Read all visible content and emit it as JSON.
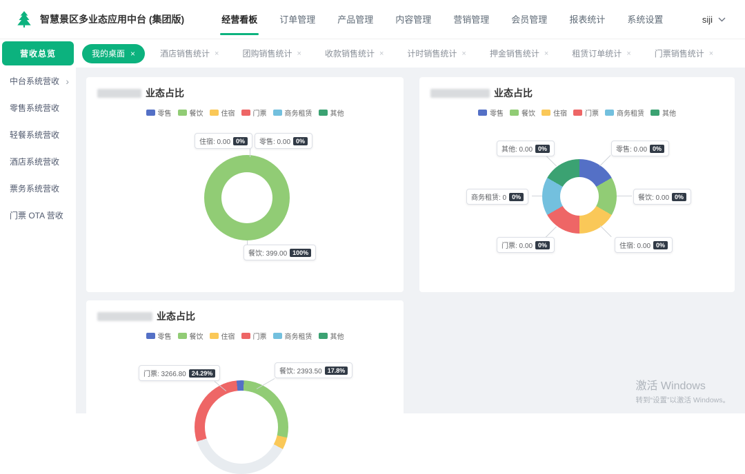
{
  "header": {
    "title": "智慧景区多业态应用中台 (集团版)",
    "nav_items": [
      {
        "label": "经营看板",
        "active": true
      },
      {
        "label": "订单管理"
      },
      {
        "label": "产品管理"
      },
      {
        "label": "内容管理"
      },
      {
        "label": "营销管理"
      },
      {
        "label": "会员管理"
      },
      {
        "label": "报表统计"
      },
      {
        "label": "系统设置"
      }
    ],
    "user_name": "siji"
  },
  "tabbar": {
    "overview_label": "营收总览",
    "active_tab_label": "我的桌面",
    "close_glyph": "×",
    "tabs": [
      "酒店销售统计",
      "团购销售统计",
      "收款销售统计",
      "计时销售统计",
      "押金销售统计",
      "租赁订单统计",
      "门票销售统计"
    ]
  },
  "sidebar": {
    "expand_glyph": "›",
    "items": [
      "中台系统营收",
      "零售系统营收",
      "轻餐系统营收",
      "酒店系统营收",
      "票务系统营收",
      "门票 OTA 营收"
    ]
  },
  "legend": [
    {
      "label": "零售",
      "color": "#5470c6"
    },
    {
      "label": "餐饮",
      "color": "#91cc75"
    },
    {
      "label": "住宿",
      "color": "#fac858"
    },
    {
      "label": "门票",
      "color": "#ee6666"
    },
    {
      "label": "商务租赁",
      "color": "#73c0de"
    },
    {
      "label": "其他",
      "color": "#3ba272"
    }
  ],
  "cards": [
    {
      "title_suffix": "业态占比"
    },
    {
      "title_suffix": "业态占比"
    },
    {
      "title_suffix": "业态占比"
    }
  ],
  "chart_data": [
    {
      "type": "pie",
      "title": "业态占比",
      "series": [
        {
          "name": "住宿",
          "value": 0.0,
          "pct": 0
        },
        {
          "name": "零售",
          "value": 0.0,
          "pct": 0
        },
        {
          "name": "餐饮",
          "value": 399.0,
          "pct": 100
        }
      ],
      "callouts": [
        {
          "text": "住宿: 0.00",
          "pct": "0%"
        },
        {
          "text": "零售: 0.00",
          "pct": "0%"
        },
        {
          "text": "餐饮: 399.00",
          "pct": "100%"
        }
      ]
    },
    {
      "type": "pie",
      "title": "业态占比",
      "series": [
        {
          "name": "零售",
          "value": 0.0,
          "pct": 0
        },
        {
          "name": "餐饮",
          "value": 0.0,
          "pct": 0
        },
        {
          "name": "住宿",
          "value": 0.0,
          "pct": 0
        },
        {
          "name": "门票",
          "value": 0.0,
          "pct": 0
        },
        {
          "name": "商务租赁",
          "value": 0,
          "pct": 0
        },
        {
          "name": "其他",
          "value": 0.0,
          "pct": 0
        }
      ],
      "callouts": [
        {
          "text": "其他: 0.00",
          "pct": "0%"
        },
        {
          "text": "零售: 0.00",
          "pct": "0%"
        },
        {
          "text": "商务租赁: 0",
          "pct": "0%"
        },
        {
          "text": "餐饮: 0.00",
          "pct": "0%"
        },
        {
          "text": "门票: 0.00",
          "pct": "0%"
        },
        {
          "text": "住宿: 0.00",
          "pct": "0%"
        }
      ]
    },
    {
      "type": "pie",
      "title": "业态占比",
      "series": [
        {
          "name": "门票",
          "value": 3266.8,
          "pct": 24.29
        },
        {
          "name": "餐饮",
          "value": 2393.5,
          "pct": 17.8
        }
      ],
      "callouts": [
        {
          "text": "门票: 3266.80",
          "pct": "24.29%"
        },
        {
          "text": "餐饮: 2393.50",
          "pct": "17.8%"
        }
      ]
    }
  ],
  "watermark": {
    "line1": "激活 Windows",
    "line2": "转到“设置”以激活 Windows。"
  },
  "colors": {
    "brand_green": "#0cb27e",
    "badge_bg": "#313a46",
    "content_bg": "#f0f2f5"
  }
}
